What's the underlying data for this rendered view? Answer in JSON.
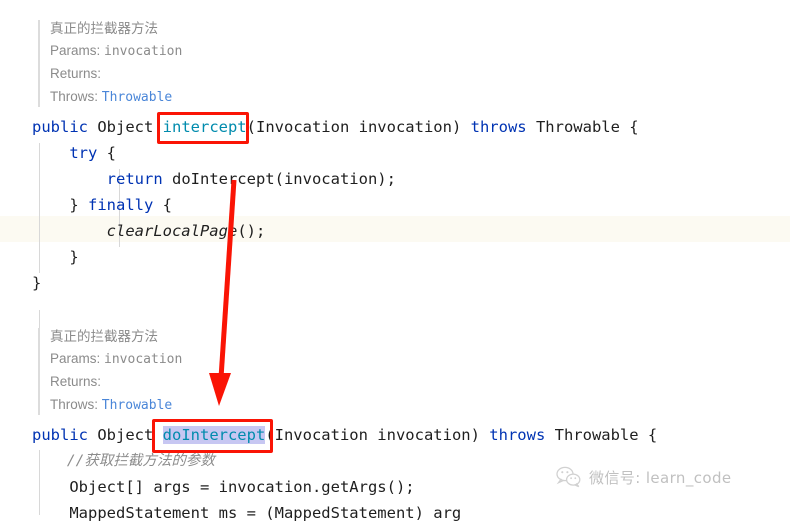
{
  "editor": {
    "doc_popup_1": {
      "summary": "真正的拦截器方法",
      "params_label": "Params:",
      "params_value": "invocation",
      "returns_label": "Returns:",
      "returns_value": "",
      "throws_label": "Throws:",
      "throws_value": "Throwable"
    },
    "doc_popup_2": {
      "summary": "真正的拦截器方法",
      "params_label": "Params:",
      "params_value": "invocation",
      "returns_label": "Returns:",
      "returns_value": "",
      "throws_label": "Throws:",
      "throws_value": "Throwable"
    },
    "code_block_1": {
      "line1_kw1": "public",
      "line1_type": " Object ",
      "line1_method": "intercept",
      "line1_args": "(Invocation invocation) ",
      "line1_kw2": "throws",
      "line1_tail": " Throwable {",
      "line2": "    ",
      "line2_kw": "try",
      "line2_tail": " {",
      "line3": "        ",
      "line3_kw": "return",
      "line3_tail": " doIntercept(invocation);",
      "line4": "    } ",
      "line4_kw": "finally",
      "line4_tail": " {",
      "line5_indent": "        ",
      "line5_call": "clearLocalPage",
      "line5_tail": "();",
      "line6": "    }",
      "line7": "}"
    },
    "code_block_2": {
      "line1_kw1": "public",
      "line1_type": " Object ",
      "line1_method": "doIntercept",
      "line1_args": "(Invocation invocation) ",
      "line1_kw2": "throws",
      "line1_tail": " Throwable {",
      "line2_comment": "    //获取拦截方法的参数",
      "line3": "    Object[] args = invocation.getArgs();",
      "line4": "    MappedStatement ms = (MappedStatement) arg"
    },
    "selection_text": "doIntercept",
    "colors": {
      "keyword": "#0033b3",
      "method": "#008bad",
      "annotation_red": "#fa1405",
      "selection": "#c7c7f2",
      "current_line": "#fcfaf2",
      "doc_text": "#8b8b8b",
      "doc_link": "#4a86d8"
    }
  },
  "annotations": {
    "box_1_target": "intercept",
    "box_2_target": "doIntercept",
    "arrow_label": "down-arrow-intercept-to-dointercept"
  },
  "watermark": {
    "icon": "wechat-icon",
    "text": "微信号: learn_code"
  }
}
